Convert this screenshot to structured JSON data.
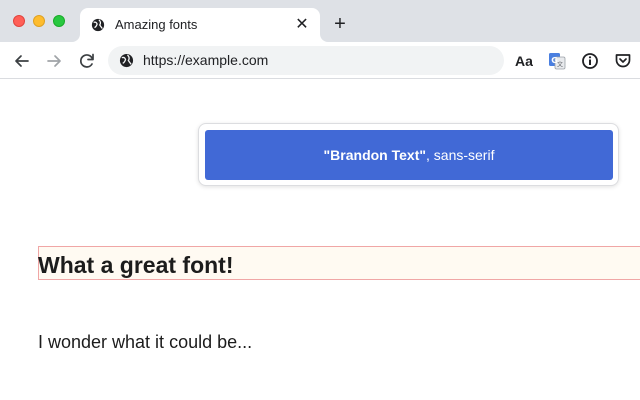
{
  "tab": {
    "title": "Amazing fonts",
    "close_icon": "close-icon",
    "favicon": "globe-icon"
  },
  "new_tab_icon": "plus-icon",
  "address_bar": {
    "url": "https://example.com",
    "icon": "globe-icon"
  },
  "extensions": {
    "font": "Aa",
    "translate": "translate-icon",
    "info": "info-icon",
    "pocket": "pocket-icon"
  },
  "popup": {
    "font_name": "\"Brandon Text\"",
    "font_fallback": ", sans-serif",
    "accent_color": "#4169d6"
  },
  "page": {
    "heading": "What a great font!",
    "paragraph": "I wonder what it could be..."
  },
  "colors": {
    "highlight_border": "#f0a6a6",
    "highlight_fill": "#fffaf2"
  }
}
